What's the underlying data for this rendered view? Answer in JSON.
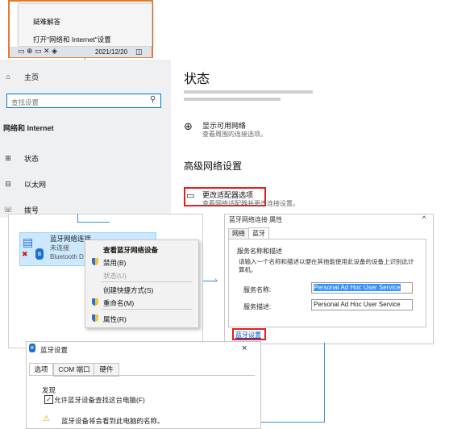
{
  "top_menu": {
    "item1": "疑难解答",
    "item2": "打开\"网络和 Internet\"设置",
    "date": "2021/12/20"
  },
  "settings_nav": {
    "home": "主页",
    "search_placeholder": "查找设置",
    "section": "网络和 Internet",
    "status": "状态",
    "ethernet": "以太网",
    "dialup": "拨号"
  },
  "status_page": {
    "title": "状态",
    "show_networks_title": "显示可用网络",
    "show_networks_desc": "查看周围的连接选项。",
    "advanced_title": "高级网络设置",
    "adapter_title": "更改适配器选项",
    "adapter_desc": "查看网络适配器并更改连接设置。"
  },
  "bt_connection": {
    "name": "蓝牙网络连接",
    "status": "未连接",
    "device": "Bluetooth D"
  },
  "context_menu": {
    "view": "查看蓝牙网络设备",
    "disable": "禁用(B)",
    "status": "状态(U)",
    "shortcut": "创建快捷方式(S)",
    "rename": "重命名(M)",
    "properties": "属性(R)"
  },
  "properties_dialog": {
    "title": "蓝牙网络连接 属性",
    "tab_network": "网络",
    "tab_bluetooth": "蓝牙",
    "group": "服务名称和描述",
    "hint": "请输入一个名称和描述以便在其他能使用此设备的设备上识别此计算机。",
    "service_name_label": "服务名称:",
    "service_name_value": "Personal Ad Hoc User Service",
    "service_desc_label": "服务描述:",
    "service_desc_value": "Personal Ad Hoc User Service",
    "more_link": "蓝牙设置"
  },
  "bt_settings": {
    "title": "蓝牙设置",
    "tab_options": "选项",
    "tab_com": "COM 端口",
    "tab_hardware": "硬件",
    "group": "发现",
    "checkbox": "允许蓝牙设备查找这台电脑(F)",
    "warning": "蓝牙设备将会看到此电脑的名称。",
    "close": "×"
  },
  "colors": {
    "accent": "#0078d7",
    "highlight": "#e02020",
    "orange": "#e8792a",
    "arrow": "#3b8fd4"
  }
}
